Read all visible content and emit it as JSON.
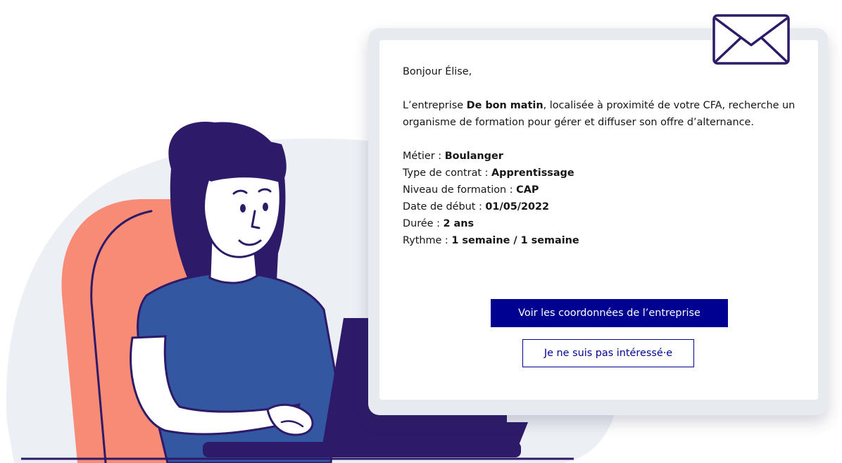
{
  "email": {
    "greeting": "Bonjour Élise,",
    "intro_before": "L’entreprise ",
    "company_name": "De bon matin",
    "intro_after": ", localisée à proximité de votre CFA, recherche un organisme de formation pour gérer et diffuser son offre d’alternance.",
    "details": [
      {
        "label": "Métier : ",
        "value": "Boulanger"
      },
      {
        "label": "Type de contrat : ",
        "value": "Apprentissage"
      },
      {
        "label": "Niveau de formation : ",
        "value": "CAP"
      },
      {
        "label": "Date de début : ",
        "value": "01/05/2022"
      },
      {
        "label": "Durée : ",
        "value": "2 ans"
      },
      {
        "label": "Rythme : ",
        "value": "1 semaine / 1 semaine"
      }
    ]
  },
  "actions": {
    "primary_label": "Voir les coordonnées de l’entreprise",
    "secondary_label": "Je ne suis pas intéressé·e"
  },
  "icons": {
    "envelope": "envelope-icon"
  },
  "colors": {
    "primary": "#000091",
    "navy_ink": "#2d1b69",
    "shirt_blue": "#3357a0",
    "chair_salmon": "#f88b75",
    "blob_gray": "#eceff4",
    "card_gray": "#e7eaef"
  }
}
